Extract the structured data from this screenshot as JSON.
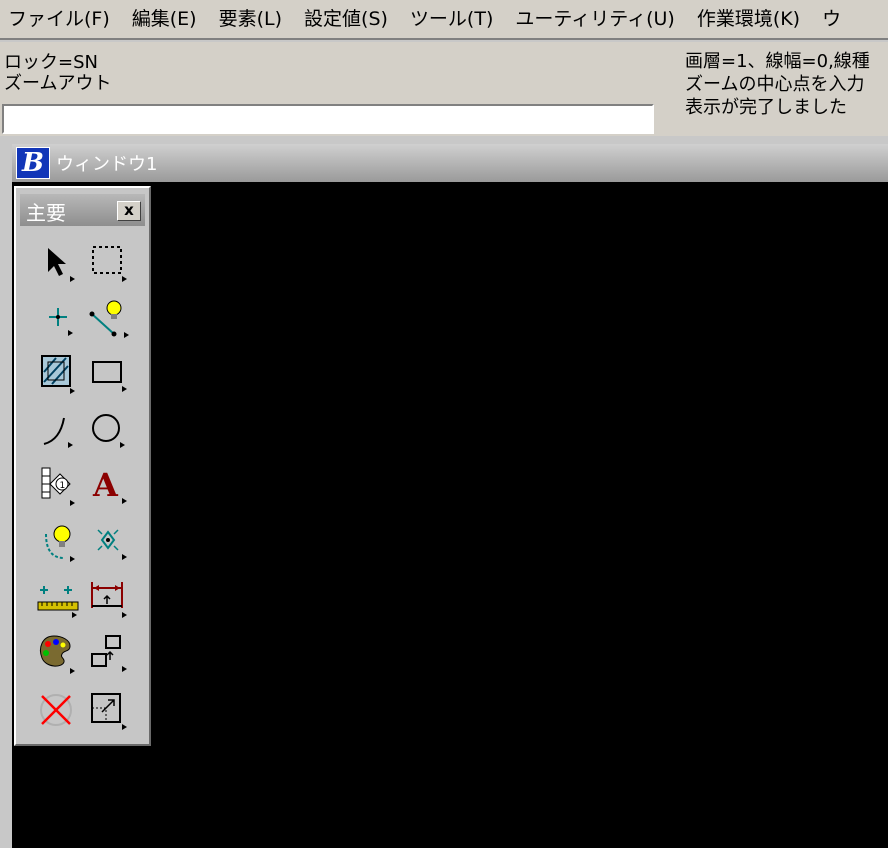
{
  "menubar": {
    "items": [
      "ファイル(F)",
      "編集(E)",
      "要素(L)",
      "設定値(S)",
      "ツール(T)",
      "ユーティリティ(U)",
      "作業環境(K)",
      "ウ"
    ]
  },
  "status": {
    "left_lines": [
      "ロック=SN",
      "ズームアウト"
    ],
    "right_lines": [
      "画層=1、線幅=0,線種",
      "ズームの中心点を入力",
      "表示が完了しました"
    ]
  },
  "key_input": {
    "value": ""
  },
  "window": {
    "title": "ウィンドウ1",
    "icon_letter": "B"
  },
  "toolbox": {
    "title": "主要",
    "close_label": "x",
    "tools": [
      "select-arrow-icon",
      "fence-selection-icon",
      "place-point-icon",
      "smart-line-icon",
      "hatch-area-icon",
      "rectangle-icon",
      "arc-icon",
      "circle-icon",
      "cell-tag-icon",
      "text-icon",
      "smartmatch-icon",
      "dimension-point-icon",
      "measure-distance-icon",
      "dimension-icon",
      "palette-icon",
      "copy-move-icon",
      "delete-icon",
      "scale-icon"
    ]
  },
  "colors": {
    "menu_bg": "#d4d0c8",
    "canvas_bg": "#000000",
    "toolbox_bg": "#c6c6c6",
    "teal_icon": "#008080",
    "text_red": "#8b0000"
  }
}
